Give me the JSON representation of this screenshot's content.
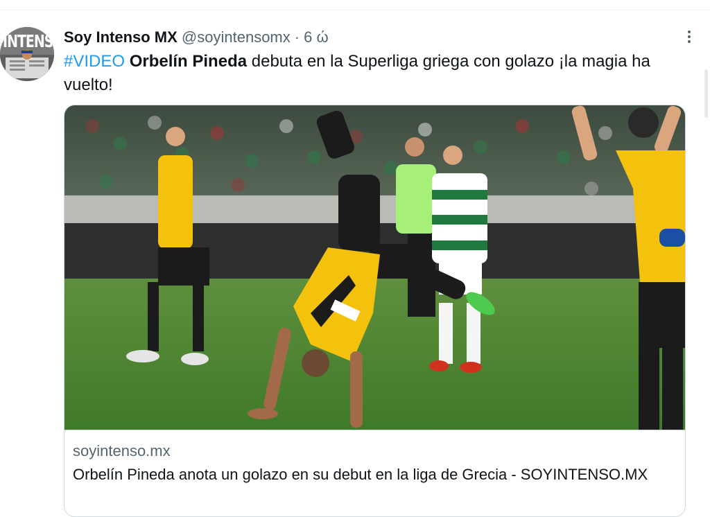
{
  "tweet": {
    "author_name": "Soy Intenso MX",
    "author_handle": "@soyintensomx",
    "separator": "·",
    "timestamp": "6 ώ",
    "more_icon": "more-dots-icon",
    "avatar_text": "INTENSO",
    "text": {
      "hashtag": "#VIDEO",
      "bold_name": "Orbelín Pineda",
      "rest": " debuta en la Superliga griega con golazo ¡la magia ha vuelto!"
    }
  },
  "card": {
    "domain": "soyintenso.mx",
    "title": "Orbelín Pineda anota un golazo en su debut en la liga de Grecia - SOYINTENSO.MX",
    "image_shirt_sponsor": "bwin",
    "image_sleeve_sponsor": "car"
  },
  "colors": {
    "link_blue": "#1d9bf0",
    "secondary_text": "#536471",
    "border": "#cfd9de",
    "jersey_yellow": "#f4c20d"
  }
}
